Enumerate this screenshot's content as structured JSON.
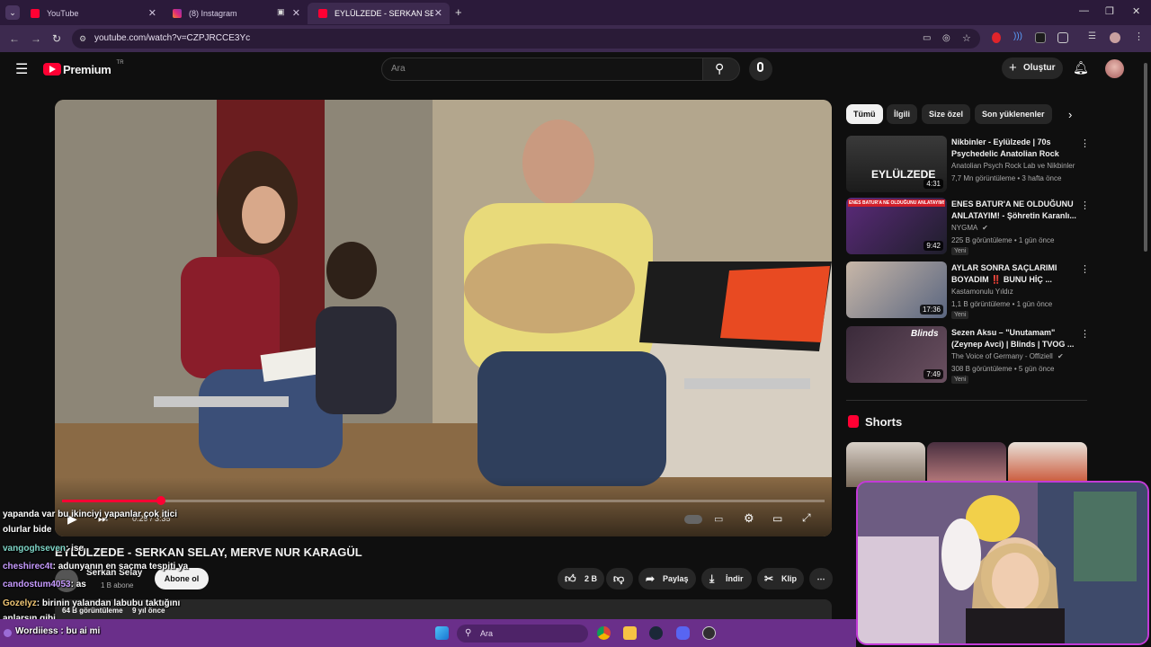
{
  "browser": {
    "tabs": [
      {
        "title": "YouTube"
      },
      {
        "title": "(8) Instagram"
      },
      {
        "title": "EYLÜLZEDE - SERKAN SELAY, M"
      }
    ],
    "url": "youtube.com/watch?v=CZPJRCCE3Yc"
  },
  "masthead": {
    "logo": "Premium",
    "region": "TR",
    "search_placeholder": "Ara",
    "create_label": "Oluştur"
  },
  "player": {
    "progress_fraction": 0.13,
    "time": "0:29 / 3:35"
  },
  "video": {
    "title": "EYLÜLZEDE - SERKAN SELAY, MERVE NUR KARAGÜL",
    "channel": "Serkan Selay",
    "subscribers": "1 B abone",
    "subscribe_label": "Abone ol",
    "likes": "2 B",
    "share_label": "Paylaş",
    "download_label": "İndir",
    "clip_label": "Klip",
    "views": "64 B görüntüleme",
    "age": "9 yıl önce"
  },
  "chips": [
    {
      "label": "Tümü"
    },
    {
      "label": "İlgili"
    },
    {
      "label": "Size özel"
    },
    {
      "label": "Son yüklenenler"
    }
  ],
  "recommendations": [
    {
      "title": "Nikbinler - Eylülzede | 70s Psychedelic Anatolian Rock",
      "channel": "Anatolian Psych Rock Lab ve Nikbinler",
      "meta": "7,7 Mn görüntüleme • 3 hafta önce",
      "duration": "4:31",
      "badge": "",
      "thumb_text": "EYLÜLZEDE"
    },
    {
      "title": "ENES BATUR'A NE OLDUĞUNU ANLATAYIM! - Şöhretin Karanlı...",
      "channel": "NYGMA",
      "meta": "225 B görüntüleme • 1 gün önce",
      "duration": "9:42",
      "badge": "Yeni",
      "thumb_text": "ENES BATUR'A NE OLDUĞUNU ANLATAYIM!"
    },
    {
      "title": "AYLAR SONRA SAÇLARIMI BOYADIM ‼️ BUNU HİÇ ...",
      "channel": "Kastamonulu Yıldız",
      "meta": "1,1 B görüntüleme • 1 gün önce",
      "duration": "17:36",
      "badge": "Yeni",
      "thumb_text": ""
    },
    {
      "title": "Sezen Aksu – \"Unutamam\" (Zeynep Avci) | Blinds | TVOG ...",
      "channel": "The Voice of Germany - Offiziell",
      "meta": "308 B görüntüleme • 5 gün önce",
      "duration": "7:49",
      "badge": "Yeni",
      "thumb_text": "Blinds"
    }
  ],
  "shorts_title": "Shorts",
  "chat": [
    {
      "user": "",
      "text": "yapanda var bu ikinciyi yapanlar çok itici"
    },
    {
      "user": "",
      "text": "olurlar bide"
    },
    {
      "user": "vangoghseven",
      "text": ": ise"
    },
    {
      "user": "cheshirec4t",
      "text": ": adunyanın en saçma tespiti ya"
    },
    {
      "user": "candostum4053",
      "text": ": as"
    },
    {
      "user": "Gozelyz",
      "text": ": birinin yalandan labubu taktığını"
    },
    {
      "user": "",
      "text": "anlarsın gibi"
    },
    {
      "user": "Wordiiess",
      "text": ": bu ai mi"
    }
  ],
  "taskbar": {
    "search_placeholder": "Ara"
  },
  "colors": {
    "accent_red": "#ff0033",
    "chrome_purple": "#3d2a4f",
    "taskbar_purple": "#6a2f8a",
    "cam_border": "#c23ad7"
  }
}
